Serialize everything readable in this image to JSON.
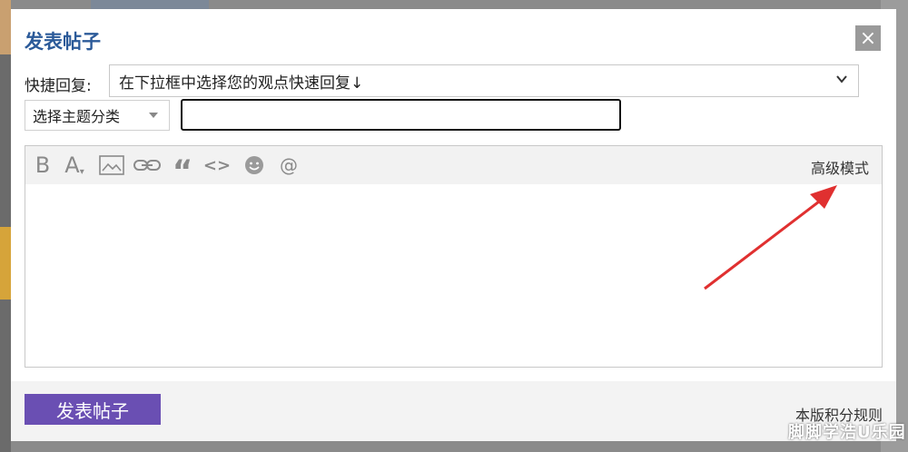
{
  "dialog": {
    "title": "发表帖子",
    "close_symbol": "×"
  },
  "quick_reply": {
    "label": "快捷回复:",
    "selected": "在下拉框中选择您的观点快速回复↓"
  },
  "topic": {
    "selected": "选择主题分类",
    "title_value": ""
  },
  "toolbar": {
    "bold": "B",
    "font_color": "A",
    "quote": "“",
    "code": "<>",
    "at": "@",
    "advanced_mode": "高级模式"
  },
  "editor": {
    "content": ""
  },
  "footer": {
    "submit_label": "发表帖子",
    "rules_label": "本版积分规则"
  },
  "watermark": "脚脚学浩U乐园",
  "colors": {
    "title": "#2b5a99",
    "submit_bg": "#6a4fb3",
    "annotation_arrow": "#e03030"
  }
}
